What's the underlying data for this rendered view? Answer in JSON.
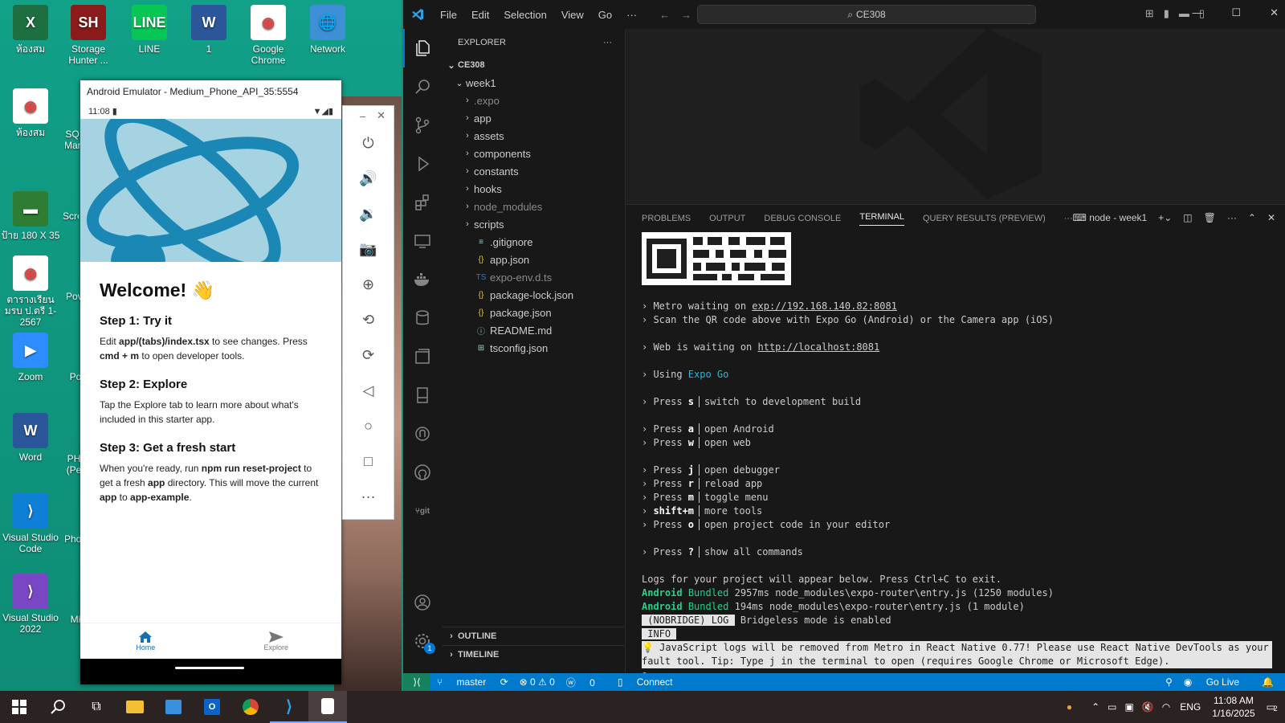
{
  "desktop": {
    "icons": [
      {
        "label": "ห้องสม",
        "color": "#1d6f42",
        "glyph": "X"
      },
      {
        "label": "Storage Hunter ...",
        "color": "#8b1a1a",
        "glyph": "SH"
      },
      {
        "label": "LINE",
        "color": "#06c755",
        "glyph": "LINE"
      },
      {
        "label": "1",
        "color": "#2b579a",
        "glyph": "W"
      },
      {
        "label": "Google Chrome",
        "color": "#ffffff",
        "glyph": "◉"
      },
      {
        "label": "Network",
        "color": "#3d8fd6",
        "glyph": "🌐"
      },
      {
        "label": "ห้องสม",
        "color": "#ffffff",
        "glyph": "◉"
      },
      {
        "label": "ป้าย 180 X 35",
        "color": "#2e7d32",
        "glyph": "▬"
      },
      {
        "label": "ตารางเรียน มรบ ป.ตรี 1-2567",
        "color": "#ffffff",
        "glyph": "◉"
      },
      {
        "label": "Zoom",
        "color": "#2d8cff",
        "glyph": "▶"
      },
      {
        "label": "Word",
        "color": "#2b579a",
        "glyph": "W"
      },
      {
        "label": "Visual Studio Code",
        "color": "#0e7fd6",
        "glyph": "⟩"
      },
      {
        "label": "Visual Studio 2022",
        "color": "#7a47c4",
        "glyph": "⟩"
      }
    ],
    "partial_labels": [
      "SQ Mar",
      "Scre",
      "Pov",
      "Po",
      "PH (Pe",
      "Pho",
      "Mi"
    ]
  },
  "emulator": {
    "title": "Android Emulator - Medium_Phone_API_35:5554",
    "status_time": "11:08",
    "welcome": "Welcome! 👋",
    "step1_title": "Step 1: Try it",
    "step1_a": "Edit ",
    "step1_b": "app/(tabs)/index.tsx",
    "step1_c": " to see changes. Press ",
    "step1_d": "cmd + m",
    "step1_e": " to open developer tools.",
    "step2_title": "Step 2: Explore",
    "step2_text": "Tap the Explore tab to learn more about what's included in this starter app.",
    "step3_title": "Step 3: Get a fresh start",
    "step3_a": "When you're ready, run ",
    "step3_b": "npm run reset-project",
    "step3_c": " to get a fresh ",
    "step3_d": "app",
    "step3_e": " directory. This will move the current ",
    "step3_f": "app",
    "step3_g": " to ",
    "step3_h": "app-example",
    "step3_i": ".",
    "tab_home": "Home",
    "tab_explore": "Explore",
    "toolbar": [
      "power-icon",
      "volume-up-icon",
      "volume-down-icon",
      "camera-icon",
      "zoom-icon",
      "rotate-left-icon",
      "rotate-right-icon",
      "back-icon",
      "home-icon",
      "overview-icon",
      "more-icon"
    ]
  },
  "vscode": {
    "menu": [
      "File",
      "Edit",
      "Selection",
      "View",
      "Go",
      "···"
    ],
    "search": "CE308",
    "explorer_title": "EXPLORER",
    "root": "CE308",
    "tree": [
      {
        "name": "week1",
        "kind": "folder-open",
        "depth": 1
      },
      {
        "name": ".expo",
        "kind": "folder",
        "depth": 2,
        "dim": true
      },
      {
        "name": "app",
        "kind": "folder",
        "depth": 2
      },
      {
        "name": "assets",
        "kind": "folder",
        "depth": 2
      },
      {
        "name": "components",
        "kind": "folder",
        "depth": 2
      },
      {
        "name": "constants",
        "kind": "folder",
        "depth": 2
      },
      {
        "name": "hooks",
        "kind": "folder",
        "depth": 2
      },
      {
        "name": "node_modules",
        "kind": "folder",
        "depth": 2,
        "dim": true
      },
      {
        "name": "scripts",
        "kind": "folder",
        "depth": 2
      },
      {
        "name": ".gitignore",
        "kind": "file",
        "icon": "≡",
        "depth": 2
      },
      {
        "name": "app.json",
        "kind": "file",
        "icon": "{}",
        "depth": 2
      },
      {
        "name": "expo-env.d.ts",
        "kind": "file",
        "icon": "TS",
        "depth": 2,
        "dim": true
      },
      {
        "name": "package-lock.json",
        "kind": "file",
        "icon": "{}",
        "depth": 2
      },
      {
        "name": "package.json",
        "kind": "file",
        "icon": "{}",
        "depth": 2
      },
      {
        "name": "README.md",
        "kind": "file",
        "icon": "ⓘ",
        "depth": 2
      },
      {
        "name": "tsconfig.json",
        "kind": "file",
        "icon": "⊞",
        "depth": 2
      }
    ],
    "outline": "OUTLINE",
    "timeline": "TIMELINE",
    "panel_tabs": [
      "PROBLEMS",
      "OUTPUT",
      "DEBUG CONSOLE",
      "TERMINAL",
      "QUERY RESULTS (PREVIEW)",
      "···"
    ],
    "terminal_name": "node - week1",
    "terminal": {
      "metro_prefix": "› Metro waiting on ",
      "metro_url": "exp://192.168.140.82:8081",
      "scan": "› Scan the QR code above with Expo Go (Android) or the Camera app (iOS)",
      "web_prefix": "› Web is waiting on ",
      "web_url": "http://localhost:8081",
      "using_prefix": "› Using ",
      "using_value": "Expo Go",
      "keys": [
        {
          "group": 1,
          "press": "› Press ",
          "key": "s",
          "desc": "switch to development build"
        },
        {
          "group": 2,
          "press": "› Press ",
          "key": "a",
          "desc": "open Android"
        },
        {
          "group": 2,
          "press": "› Press ",
          "key": "w",
          "desc": "open web"
        },
        {
          "group": 3,
          "press": "› Press ",
          "key": "j",
          "desc": "open debugger"
        },
        {
          "group": 3,
          "press": "› Press ",
          "key": "r",
          "desc": "reload app"
        },
        {
          "group": 3,
          "press": "› Press ",
          "key": "m",
          "desc": "toggle menu"
        },
        {
          "group": 3,
          "press": "› ",
          "key": "shift+m",
          "desc": "more tools"
        },
        {
          "group": 3,
          "press": "› Press ",
          "key": "o",
          "desc": "open project code in your editor"
        },
        {
          "group": 4,
          "press": "› Press ",
          "key": "?",
          "desc": "show all commands"
        }
      ],
      "logs_line": "Logs for your project will appear below. Press Ctrl+C to exit.",
      "bundle1_a": "Android",
      "bundle1_b": "Bundled",
      "bundle1_c": " 2957ms node_modules\\expo-router\\entry.js (1250 modules)",
      "bundle2_a": "Android",
      "bundle2_b": "Bundled",
      "bundle2_c": " 194ms node_modules\\expo-router\\entry.js (1 module)",
      "nobridge": " (NOBRIDGE) LOG ",
      "nobridge_msg": " Bridgeless mode is enabled",
      "info": " INFO ",
      "warn1": "💡 JavaScript logs will be removed from Metro in React Native 0.77! Please use React Native DevTools as your de",
      "warn2": "fault tool. Tip: Type j in the terminal to open (requires Google Chrome or Microsoft Edge)."
    },
    "status": {
      "branch": "master",
      "problems": "⊗ 0 ⚠ 0",
      "ports": "0",
      "connect": "Connect",
      "go_live": "Go Live"
    }
  },
  "taskbar": {
    "lang": "ENG",
    "time": "11:08 AM",
    "date": "1/16/2025",
    "notifications": "2"
  }
}
